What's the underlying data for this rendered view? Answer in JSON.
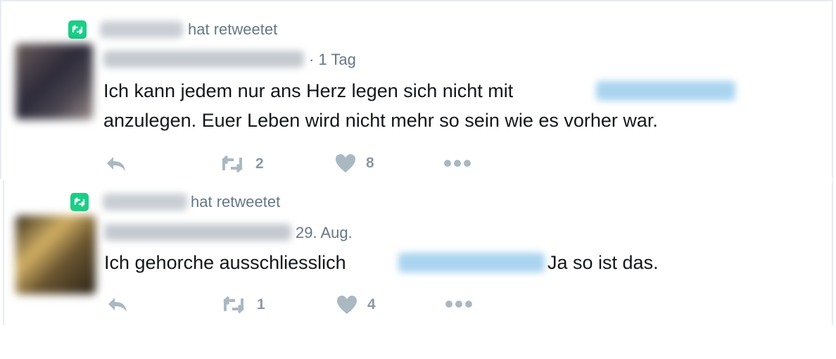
{
  "tweets": [
    {
      "retweet_label": "hat retweetet",
      "time": "· 1 Tag",
      "text_line1": "Ich kann jedem nur ans Herz legen sich nicht mit",
      "text_line2": "anzulegen. Euer Leben wird nicht mehr so sein wie es vorher war.",
      "retweets": "2",
      "likes": "8"
    },
    {
      "retweet_label": "hat retweetet",
      "time": "29. Aug.",
      "text_before": "Ich gehorche ausschliesslich",
      "text_after": "Ja so ist das.",
      "retweets": "1",
      "likes": "4"
    }
  ],
  "colors": {
    "retweet_badge": "#19cf86",
    "icon_gray": "#aab8c2",
    "secondary_text": "#657786",
    "mention_blue": "#a9d4f0"
  },
  "icons": [
    "retweet-badge-icon",
    "reply-icon",
    "retweet-icon",
    "like-icon",
    "more-icon"
  ]
}
